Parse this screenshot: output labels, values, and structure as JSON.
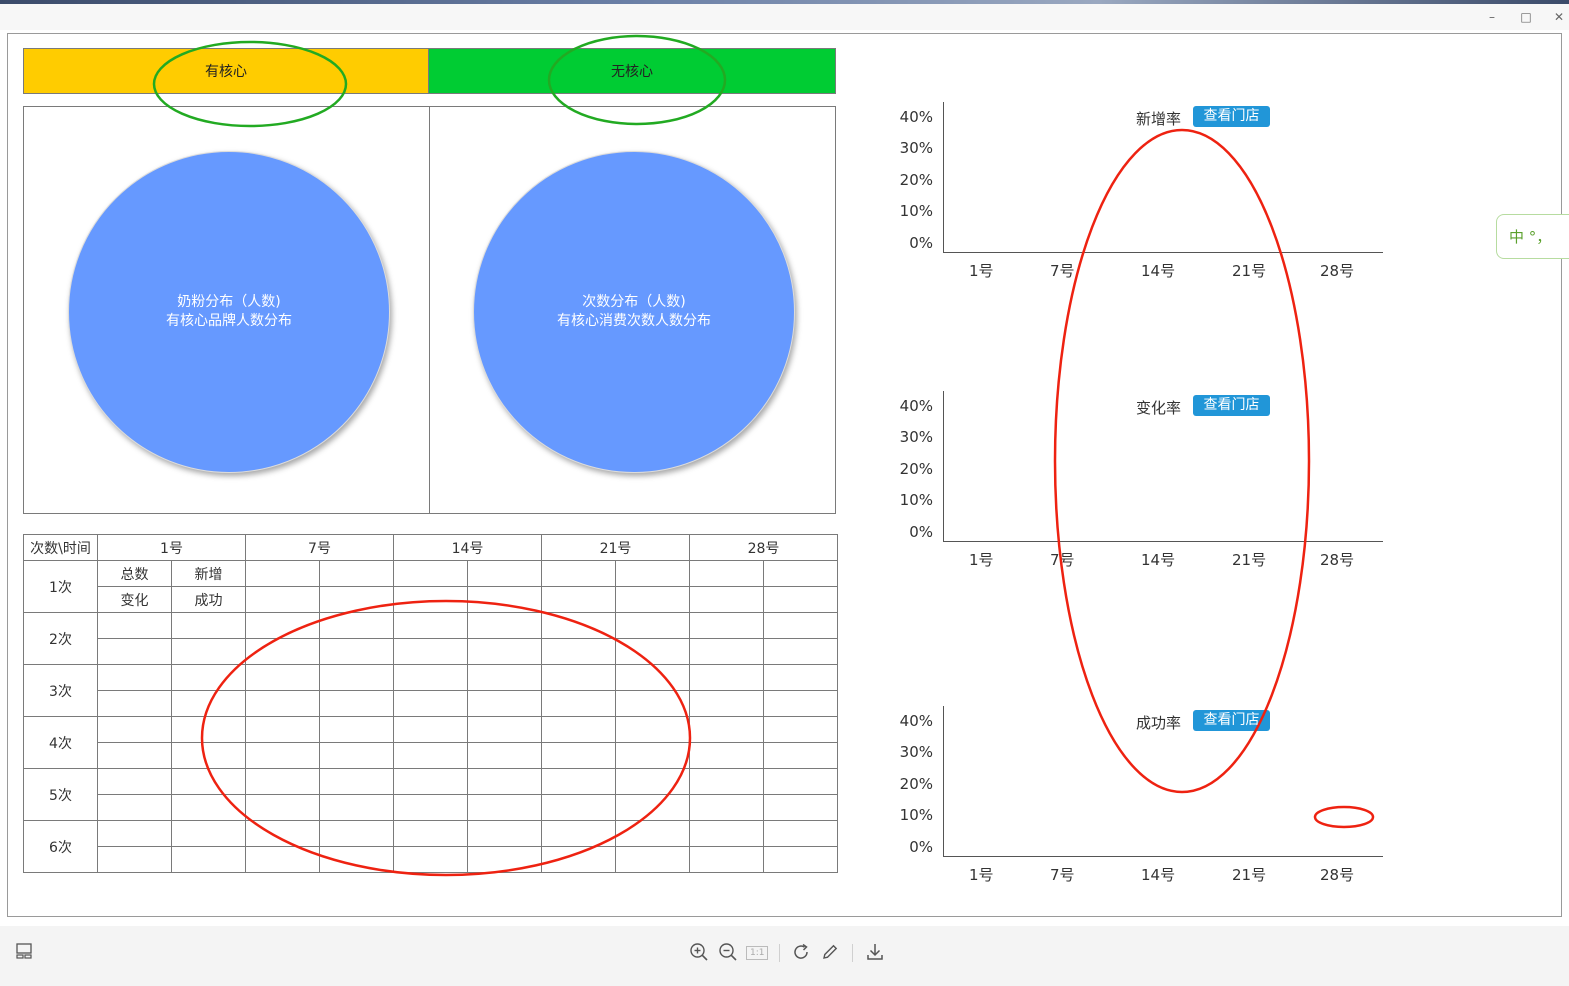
{
  "window": {
    "minimize": "–",
    "maximize": "□",
    "close": "✕"
  },
  "header": {
    "left": {
      "label": "有核心",
      "color": "#ffcc00"
    },
    "right": {
      "label": "无核心",
      "color": "#00cc33"
    }
  },
  "pies": [
    {
      "line1": "奶粉分布（人数)",
      "line2": "有核心品牌人数分布",
      "color": "#6699ff"
    },
    {
      "line1": "次数分布（人数)",
      "line2": "有核心消费次数人数分布",
      "color": "#6699ff"
    }
  ],
  "table": {
    "corner": "次数\\时间",
    "dates": [
      "1号",
      "7号",
      "14号",
      "21号",
      "28号"
    ],
    "rows": [
      "1次",
      "2次",
      "3次",
      "4次",
      "5次",
      "6次"
    ],
    "legend": {
      "total": "总数",
      "new": "新增",
      "change": "变化",
      "success": "成功"
    }
  },
  "charts": [
    {
      "title": "新增率",
      "button": "查看门店"
    },
    {
      "title": "变化率",
      "button": "查看门店"
    },
    {
      "title": "成功率",
      "button": "查看门店"
    }
  ],
  "chart_axis": {
    "yticks": [
      "40%",
      "30%",
      "20%",
      "10%",
      "0%"
    ],
    "xticks": [
      "1号",
      "7号",
      "14号",
      "21号",
      "28号"
    ]
  },
  "chart_data": [
    {
      "type": "line",
      "title": "新增率",
      "categories": [
        "1号",
        "7号",
        "14号",
        "21号",
        "28号"
      ],
      "ylim": [
        0,
        40
      ],
      "series": []
    },
    {
      "type": "line",
      "title": "变化率",
      "categories": [
        "1号",
        "7号",
        "14号",
        "21号",
        "28号"
      ],
      "ylim": [
        0,
        40
      ],
      "series": []
    },
    {
      "type": "line",
      "title": "成功率",
      "categories": [
        "1号",
        "7号",
        "14号",
        "21号",
        "28号"
      ],
      "ylim": [
        0,
        40
      ],
      "series": []
    }
  ],
  "ime": {
    "text": "中 °，"
  },
  "toolbar": {
    "icons": [
      "layout-icon",
      "zoom-in-icon",
      "zoom-out-icon",
      "actual-size-icon",
      "rotate-icon",
      "edit-icon",
      "download-icon"
    ],
    "actual_size": "1:1"
  },
  "annotation_colors": {
    "green": "#22aa22",
    "red": "#ee2211"
  }
}
